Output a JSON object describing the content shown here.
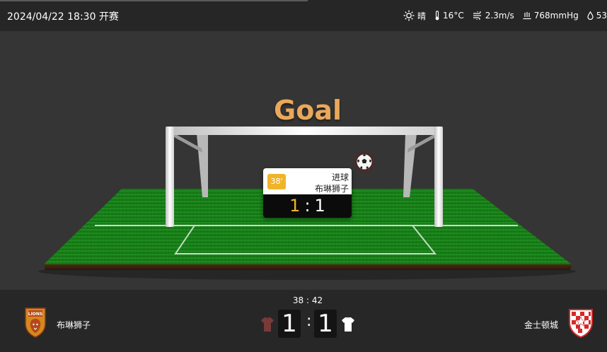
{
  "header": {
    "datetime": "2024/04/22 18:30 开赛",
    "weather": {
      "condition": "晴",
      "temperature": "16°C",
      "wind": "2.3m/s",
      "pressure": "768mmHg",
      "humidity": "53"
    }
  },
  "stage": {
    "title": "Goal",
    "event": {
      "minute": "38'",
      "type": "进球",
      "team": "布琳狮子",
      "score_home": "1",
      "score_away": "1",
      "separator": ":"
    }
  },
  "scoreboard": {
    "match_time": "38 : 42",
    "home_team": "布琳狮子",
    "away_team": "金士顿城",
    "home_score": "1",
    "away_score": "1",
    "separator": ":"
  },
  "colors": {
    "accent_gold": "#f0b429",
    "goal_title": "#e9a85a",
    "pitch_green": "#1e8a1e",
    "home_shirt": "#7a3a3a",
    "away_shirt": "#ffffff"
  }
}
